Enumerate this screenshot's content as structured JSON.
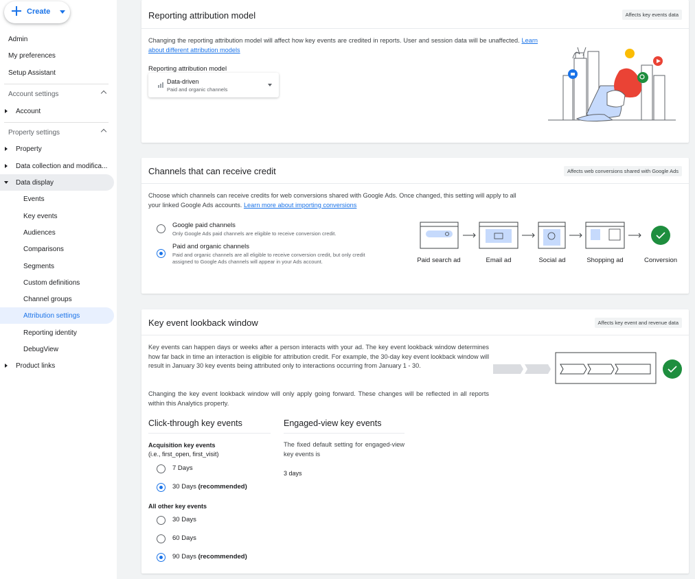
{
  "sidebar": {
    "create_label": "Create",
    "top_items": [
      "Admin",
      "My preferences",
      "Setup Assistant"
    ],
    "account_settings": {
      "label": "Account settings",
      "items": [
        "Account"
      ]
    },
    "property_settings": {
      "label": "Property settings",
      "items": [
        "Property",
        "Data collection and modifica...",
        "Data display"
      ],
      "data_display_items": [
        "Events",
        "Key events",
        "Audiences",
        "Comparisons",
        "Segments",
        "Custom definitions",
        "Channel groups",
        "Attribution settings",
        "Reporting identity",
        "DebugView"
      ],
      "product_links": "Product links"
    }
  },
  "attribution": {
    "title": "Reporting attribution model",
    "badge": "Affects key events data",
    "description": "Changing the reporting attribution model will affect how key events are credited in reports. User and session data will be unaffected.",
    "link": "Learn about different attribution models",
    "field_label": "Reporting attribution model",
    "dropdown": {
      "value": "Data-driven",
      "sub": "Paid and organic channels",
      "icon": "bar-chart-icon"
    }
  },
  "channels": {
    "title": "Channels that can receive credit",
    "badge": "Affects web conversions shared with Google Ads",
    "description": "Choose which channels can receive credits for web conversions shared with Google Ads. Once changed, this setting will apply to all your linked Google Ads accounts.",
    "link": "Learn more about importing conversions",
    "options": [
      {
        "label": "Google paid channels",
        "sub": "Only Google Ads paid channels are eligible to receive conversion credit.",
        "selected": false
      },
      {
        "label": "Paid and organic channels",
        "sub1": "Paid and organic channels are all eligible to receive conversion credit, but only credit",
        "sub2": "assigned to Google Ads channels will appear in your Ads account.",
        "selected": true
      }
    ],
    "flow": [
      "Paid search ad",
      "Email ad",
      "Social ad",
      "Shopping ad",
      "Conversion"
    ]
  },
  "lookback": {
    "title": "Key event lookback window",
    "badge": "Affects key event and revenue data",
    "description": "Key events can happen days or weeks after a person interacts with your ad. The key event lookback window determines how far back in time an interaction is eligible for attribution credit. For example, the 30-day key event lookback window will result in January 30 key events being attributed only to interactions occurring from January 1 - 30.",
    "description2": "Changing the key event lookback window will only apply going forward. These changes will be reflected in all reports within this Analytics property.",
    "click_through": {
      "title": "Click-through key events",
      "acq_label": "Acquisition key events",
      "acq_sub": "(i.e., first_open, first_visit)",
      "acq_options": [
        {
          "label": "7 Days",
          "selected": false
        },
        {
          "label": "30 Days",
          "suffix": "(recommended)",
          "selected": true
        }
      ],
      "other_label": "All other key events",
      "other_options": [
        {
          "label": "30 Days",
          "selected": false
        },
        {
          "label": "60 Days",
          "selected": false
        },
        {
          "label": "90 Days",
          "suffix": "(recommended)",
          "selected": true
        }
      ]
    },
    "engaged_view": {
      "title": "Engaged-view key events",
      "text": "The fixed default setting for engaged-view key events is",
      "value": "3 days"
    }
  },
  "colors": {
    "accent": "#1a73e8",
    "check_green": "#1e8e3e",
    "illustration_red": "#ea4335"
  }
}
